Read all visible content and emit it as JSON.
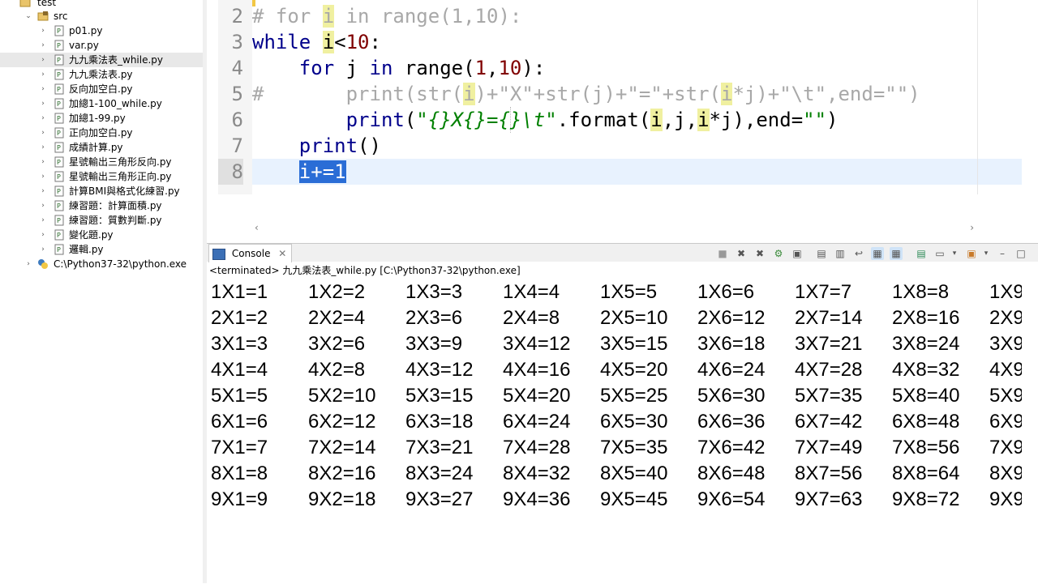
{
  "explorer": {
    "project": "test",
    "src": "src",
    "files": [
      "p01.py",
      "var.py",
      "九九乘法表_while.py",
      "九九乘法表.py",
      "反向加空白.py",
      "加總1-100_while.py",
      "加總1-99.py",
      "正向加空白.py",
      "成績計算.py",
      "星號輸出三角形反向.py",
      "星號輸出三角形正向.py",
      "計算BMI與格式化練習.py",
      "練習題：計算面積.py",
      "練習題：質數判斷.py",
      "變化題.py",
      "邏輯.py"
    ],
    "interpreter": "C:\\Python37-32\\python.exe"
  },
  "editor": {
    "lines": [
      {
        "num": "2",
        "text": "# for i in range(1,10):"
      },
      {
        "num": "3",
        "text": "while i<10:"
      },
      {
        "num": "4",
        "text": "    for j in range(1,10):"
      },
      {
        "num": "5",
        "text": "#       print(str(i)+\"X\"+str(j)+\"=\"+str(i*j)+\"\\t\",end=\"\")"
      },
      {
        "num": "6",
        "text": "        print(\"{}X{}={}\\t\".format(i,j,i*j),end=\"\")"
      },
      {
        "num": "7",
        "text": "    print()"
      },
      {
        "num": "8",
        "text": "    i+=1"
      }
    ]
  },
  "console": {
    "tab_label": "Console",
    "close": "✕",
    "status": "<terminated> 九九乘法表_while.py [C:\\Python37-32\\python.exe]",
    "rows": [
      [
        "1X1=1",
        "1X2=2",
        "1X3=3",
        "1X4=4",
        "1X5=5",
        "1X6=6",
        "1X7=7",
        "1X8=8",
        "1X9"
      ],
      [
        "2X1=2",
        "2X2=4",
        "2X3=6",
        "2X4=8",
        "2X5=10",
        "2X6=12",
        "2X7=14",
        "2X8=16",
        "2X9"
      ],
      [
        "3X1=3",
        "3X2=6",
        "3X3=9",
        "3X4=12",
        "3X5=15",
        "3X6=18",
        "3X7=21",
        "3X8=24",
        "3X9"
      ],
      [
        "4X1=4",
        "4X2=8",
        "4X3=12",
        "4X4=16",
        "4X5=20",
        "4X6=24",
        "4X7=28",
        "4X8=32",
        "4X9"
      ],
      [
        "5X1=5",
        "5X2=10",
        "5X3=15",
        "5X4=20",
        "5X5=25",
        "5X6=30",
        "5X7=35",
        "5X8=40",
        "5X9"
      ],
      [
        "6X1=6",
        "6X2=12",
        "6X3=18",
        "6X4=24",
        "6X5=30",
        "6X6=36",
        "6X7=42",
        "6X8=48",
        "6X9"
      ],
      [
        "7X1=7",
        "7X2=14",
        "7X3=21",
        "7X4=28",
        "7X5=35",
        "7X6=42",
        "7X7=49",
        "7X8=56",
        "7X9"
      ],
      [
        "8X1=8",
        "8X2=16",
        "8X3=24",
        "8X4=32",
        "8X5=40",
        "8X6=48",
        "8X7=56",
        "8X8=64",
        "8X9"
      ],
      [
        "9X1=9",
        "9X2=18",
        "9X3=27",
        "9X4=36",
        "9X5=45",
        "9X6=54",
        "9X7=63",
        "9X8=72",
        "9X9"
      ]
    ]
  },
  "colors": {
    "keyword": "#00008b",
    "comment": "#a8a8a8",
    "string": "#008000",
    "number": "#800000",
    "selection": "#2a6dd6",
    "occurrence": "#f0f0a0"
  }
}
